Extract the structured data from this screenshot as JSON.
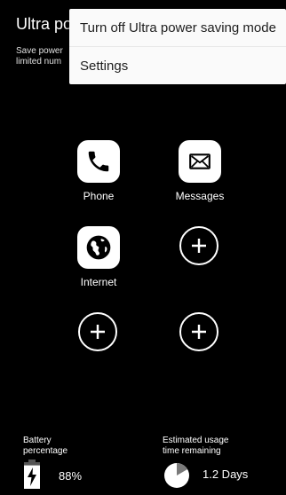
{
  "header": {
    "title": "Ultra pov",
    "description_line1": "Save power",
    "description_line2": "limited num"
  },
  "menu": {
    "items": [
      {
        "label": "Turn off Ultra power saving mode"
      },
      {
        "label": "Settings"
      }
    ]
  },
  "apps": [
    {
      "label": "Phone",
      "icon": "phone-icon"
    },
    {
      "label": "Messages",
      "icon": "envelope-icon"
    },
    {
      "label": "Internet",
      "icon": "globe-icon"
    }
  ],
  "add_slots": 3,
  "footer": {
    "battery_label_line1": "Battery",
    "battery_label_line2": "percentage",
    "battery_value": "88%",
    "battery_level": 0.88,
    "usage_label_line1": "Estimated usage",
    "usage_label_line2": "time remaining",
    "usage_value": "1.2 Days"
  },
  "colors": {
    "background": "#000000",
    "menu_background": "#fafafa",
    "icon_foreground": "#000000"
  }
}
